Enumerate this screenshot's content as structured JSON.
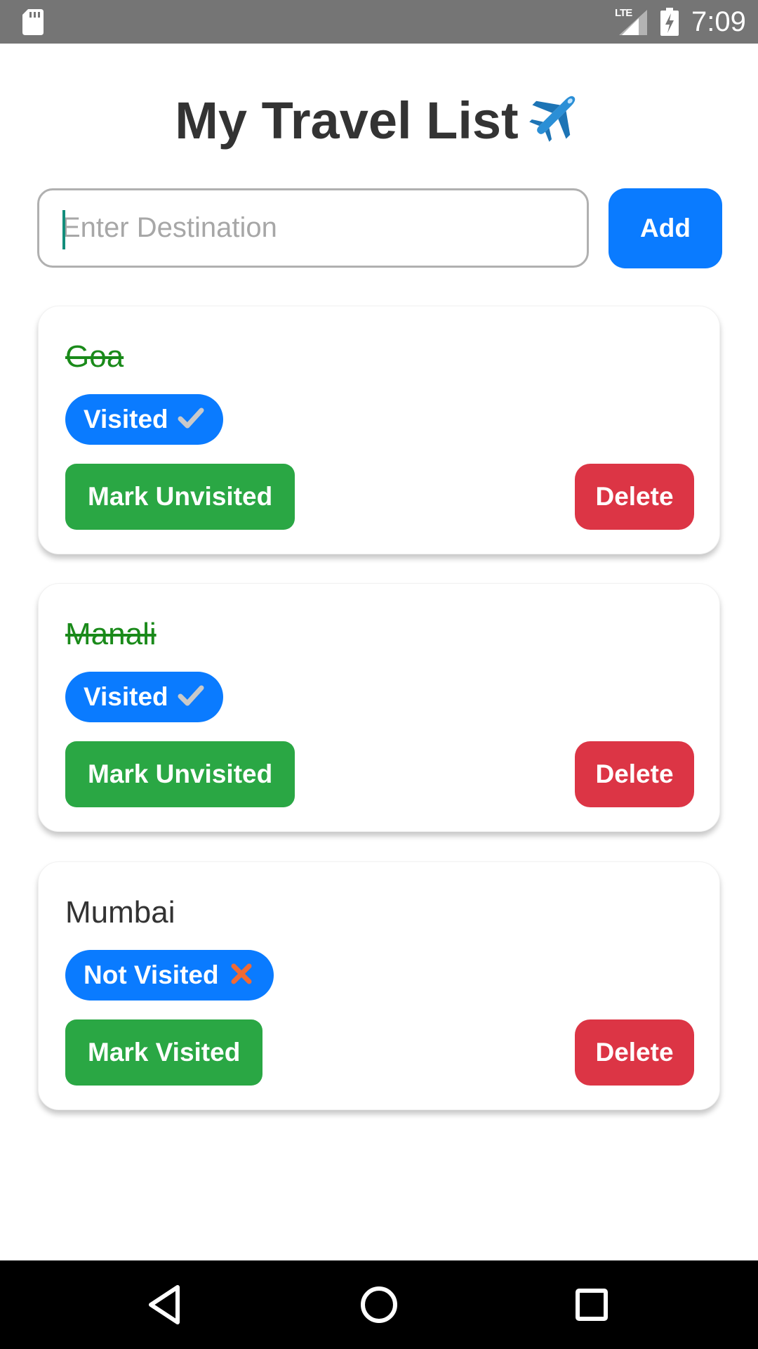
{
  "status_bar": {
    "network": "LTE",
    "time": "7:09",
    "icons": [
      "sd-card-icon",
      "signal-icon",
      "battery-charging-icon"
    ]
  },
  "header": {
    "title": "My Travel List",
    "title_icon": "airplane-icon"
  },
  "input": {
    "value": "",
    "placeholder": "Enter Destination"
  },
  "add_button": {
    "label": "Add"
  },
  "destinations": [
    {
      "name": "Goa",
      "visited": true,
      "status_label": "Visited",
      "status_icon": "check-icon",
      "toggle_label": "Mark Unvisited",
      "delete_label": "Delete"
    },
    {
      "name": "Manali",
      "visited": true,
      "status_label": "Visited",
      "status_icon": "check-icon",
      "toggle_label": "Mark Unvisited",
      "delete_label": "Delete"
    },
    {
      "name": "Mumbai",
      "visited": false,
      "status_label": "Not Visited",
      "status_icon": "cross-icon",
      "toggle_label": "Mark Visited",
      "delete_label": "Delete"
    }
  ],
  "nav_bar": {
    "buttons": [
      "back-icon",
      "home-icon",
      "recents-icon"
    ]
  },
  "colors": {
    "primary_blue": "#0a7bff",
    "success_green": "#2aa744",
    "danger_red": "#dc3545",
    "visited_text": "#1a8a1a",
    "status_bar_bg": "#757575"
  }
}
